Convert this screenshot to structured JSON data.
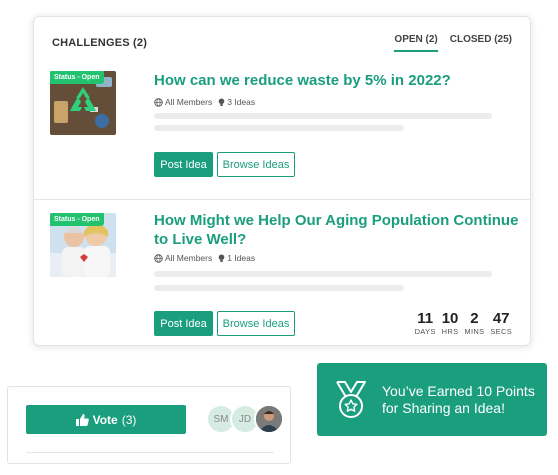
{
  "panel": {
    "title": "CHALLENGES (2)",
    "tabs": [
      {
        "label": "OPEN (2)",
        "active": true
      },
      {
        "label": "CLOSED (25)",
        "active": false
      }
    ]
  },
  "challenges": [
    {
      "status": "Status - Open",
      "title": "How can we reduce waste by 5% in 2022?",
      "audience": "All Members",
      "ideas": "3 Ideas",
      "post_label": "Post Idea",
      "browse_label": "Browse Ideas"
    },
    {
      "status": "Status - Open",
      "title_line1": "How Might we Help Our Aging Population Continue",
      "title_line2": "to Live Well?",
      "audience": "All Members",
      "ideas": "1 Ideas",
      "post_label": "Post Idea",
      "browse_label": "Browse Ideas",
      "countdown": [
        {
          "value": "11",
          "unit": "DAYS"
        },
        {
          "value": "10",
          "unit": "HRS"
        },
        {
          "value": "2",
          "unit": "MINS"
        },
        {
          "value": "47",
          "unit": "SECS"
        }
      ]
    }
  ],
  "vote": {
    "label": "Vote",
    "count": "(3)"
  },
  "voters": [
    "SM",
    "JD"
  ],
  "toast": {
    "line1": "You’ve Earned 10 Points",
    "line2": "for Sharing an Idea!"
  },
  "colors": {
    "accent": "#1a9e7e",
    "status_badge": "#22c26e"
  }
}
